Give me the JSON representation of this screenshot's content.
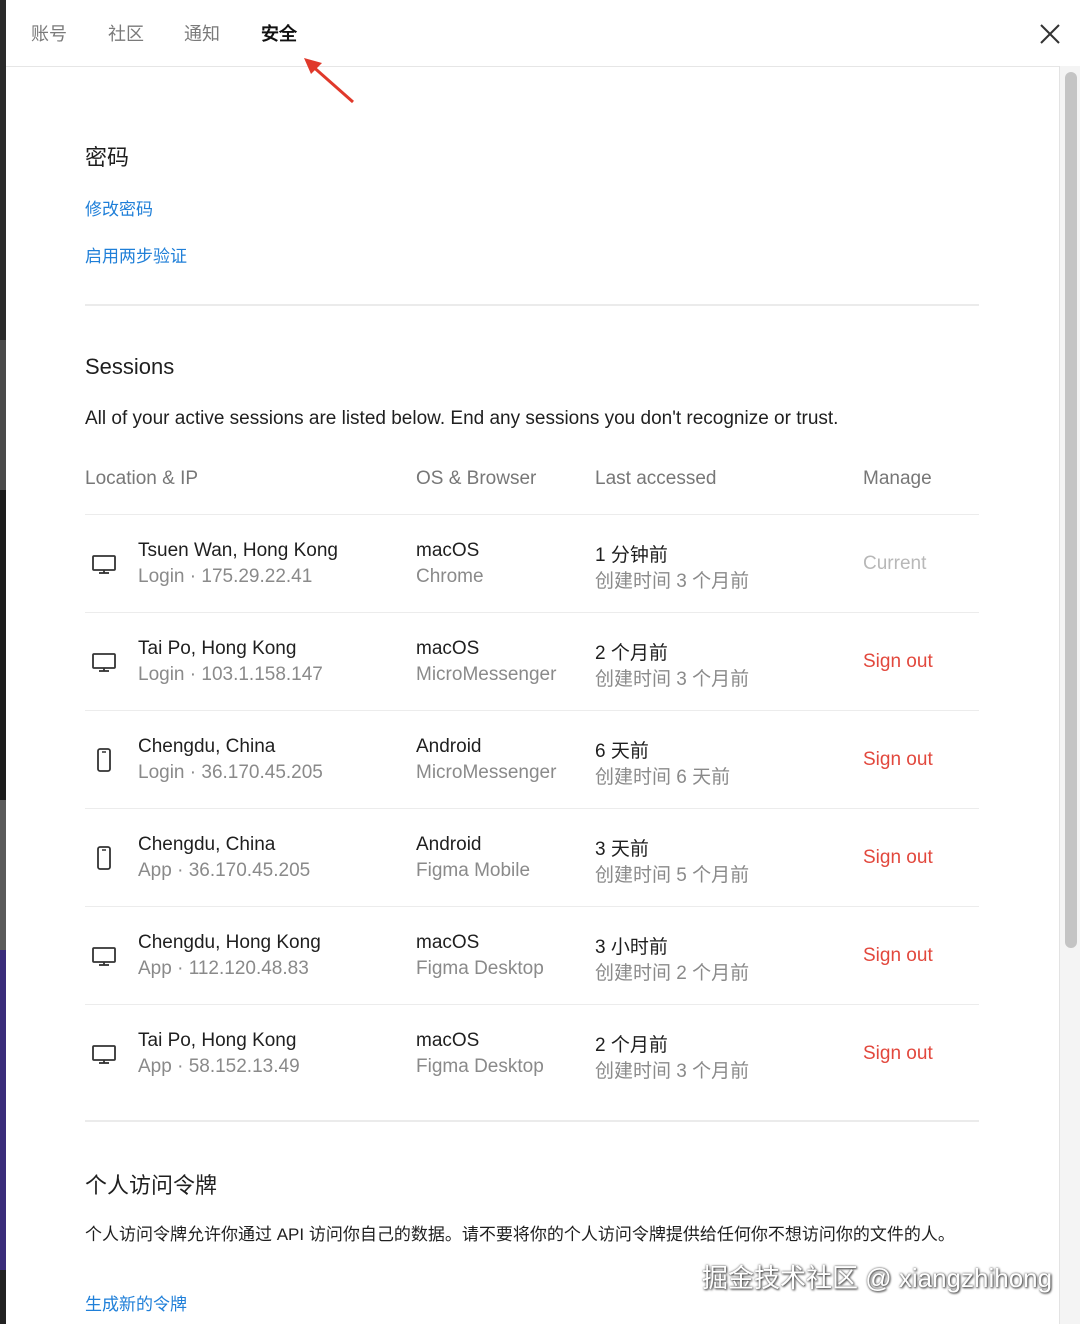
{
  "tabs": [
    {
      "label": "账号"
    },
    {
      "label": "社区"
    },
    {
      "label": "通知"
    },
    {
      "label": "安全"
    }
  ],
  "password_section": {
    "title": "密码",
    "change_password": "修改密码",
    "enable_2fa": "启用两步验证"
  },
  "sessions": {
    "title": "Sessions",
    "description": "All of your active sessions are listed below. End any sessions you don't recognize or trust.",
    "columns": [
      "Location & IP",
      "OS & Browser",
      "Last accessed",
      "Manage"
    ],
    "rows": [
      {
        "device_icon": "desktop-icon",
        "location": "Tsuen Wan, Hong Kong",
        "ip": "Login · 175.29.22.41",
        "os": "macOS",
        "browser": "Chrome",
        "last": "1 分钟前",
        "created": "创建时间 3 个月前",
        "manage": "Current"
      },
      {
        "device_icon": "desktop-icon",
        "location": "Tai Po, Hong Kong",
        "ip": "Login · 103.1.158.147",
        "os": "macOS",
        "browser": "MicroMessenger",
        "last": "2 个月前",
        "created": "创建时间 3 个月前",
        "manage": "Sign out"
      },
      {
        "device_icon": "phone-icon",
        "location": "Chengdu, China",
        "ip": "Login · 36.170.45.205",
        "os": "Android",
        "browser": "MicroMessenger",
        "last": "6 天前",
        "created": "创建时间 6 天前",
        "manage": "Sign out"
      },
      {
        "device_icon": "phone-icon",
        "location": "Chengdu, China",
        "ip": "App · 36.170.45.205",
        "os": "Android",
        "browser": "Figma Mobile",
        "last": "3 天前",
        "created": "创建时间 5 个月前",
        "manage": "Sign out"
      },
      {
        "device_icon": "desktop-icon",
        "location": "Chengdu, Hong Kong",
        "ip": "App · 112.120.48.83",
        "os": "macOS",
        "browser": "Figma Desktop",
        "last": "3 小时前",
        "created": "创建时间 2 个月前",
        "manage": "Sign out"
      },
      {
        "device_icon": "desktop-icon",
        "location": "Tai Po, Hong Kong",
        "ip": "App · 58.152.13.49",
        "os": "macOS",
        "browser": "Figma Desktop",
        "last": "2 个月前",
        "created": "创建时间 3 个月前",
        "manage": "Sign out"
      }
    ]
  },
  "tokens": {
    "title": "个人访问令牌",
    "description": "个人访问令牌允许你通过 API 访问你自己的数据。请不要将你的个人访问令牌提供给任何你不想访问你的文件的人。",
    "generate": "生成新的令牌"
  },
  "watermark": "掘金技术社区 @ xiangzhihong",
  "colors": {
    "link": "#1f7fd8",
    "sign_out": "#e2483d",
    "annotation_arrow": "#e0392b"
  }
}
